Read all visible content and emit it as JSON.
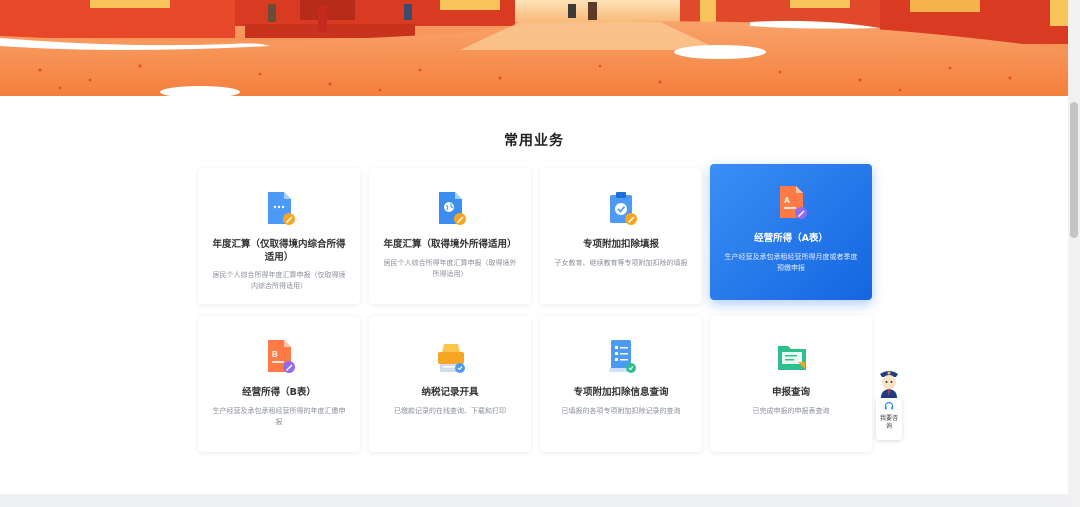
{
  "section": {
    "title": "常用业务"
  },
  "cards": [
    {
      "title": "年度汇算（仅取得境内综合所得适用）",
      "desc": "居民个人综合所得年度汇算申报（仅取得境内综合所得适用）",
      "icon": "document-edit-icon"
    },
    {
      "title": "年度汇算（取得境外所得适用）",
      "desc": "居民个人综合所得年度汇算申报（取得境外所得适用）",
      "icon": "document-globe-icon"
    },
    {
      "title": "专项附加扣除填报",
      "desc": "子女教育、继续教育等专项附加扣除的填报",
      "icon": "clipboard-check-icon"
    },
    {
      "title": "经营所得（A表）",
      "desc": "生产经营及承包承租经营所得月度或者季度预缴申报",
      "icon": "document-a-icon"
    },
    {
      "title": "经营所得（B表）",
      "desc": "生产经营及承包承租经营所得的年度汇缴申报",
      "icon": "document-b-icon"
    },
    {
      "title": "纳税记录开具",
      "desc": "已缴款记录的在线查询、下载和打印",
      "icon": "printer-icon"
    },
    {
      "title": "专项附加扣除信息查询",
      "desc": "已填报的各项专项附加扣除记录的查询",
      "icon": "scroll-list-icon"
    },
    {
      "title": "申报查询",
      "desc": "已完成申报的申报表查询",
      "icon": "folder-icon"
    }
  ],
  "assistant": {
    "label": "我要咨询"
  },
  "colors": {
    "accent": "#1565e0",
    "banner": "#f06a35"
  }
}
